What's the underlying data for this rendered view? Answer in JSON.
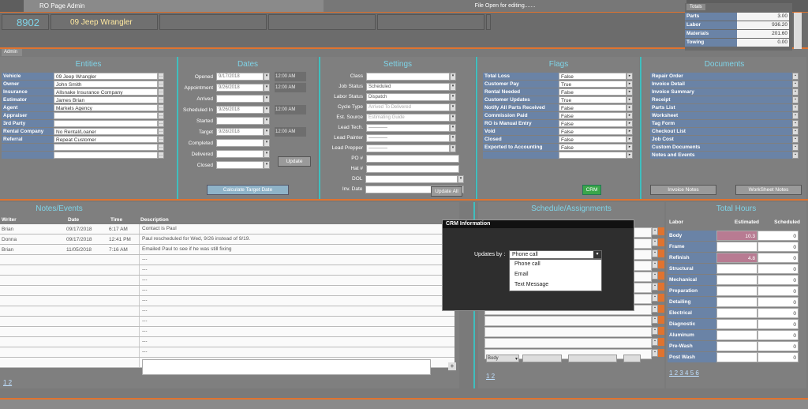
{
  "header": {
    "app_title": "RO Page Admin",
    "status_message": "File Open for editing.......",
    "ro_number": "8902",
    "vehicle_name": "09 Jeep Wrangler",
    "admin_tab": "Admin"
  },
  "totals": {
    "title": "Totals",
    "rows": [
      {
        "label": "Parts",
        "value": "3.00"
      },
      {
        "label": "Labor",
        "value": "936.20"
      },
      {
        "label": "Materials",
        "value": "201.60"
      },
      {
        "label": "Towing",
        "value": "0.00"
      }
    ]
  },
  "entities": {
    "title": "Entities",
    "rows": [
      {
        "label": "Vehicle",
        "value": "09 Jeep Wrangler"
      },
      {
        "label": "Owner",
        "value": "John Smith"
      },
      {
        "label": "Insurance",
        "value": "Allsnake Insurance Company"
      },
      {
        "label": "Estimator",
        "value": "James Brian"
      },
      {
        "label": "Agent",
        "value": "Markels Agency"
      },
      {
        "label": "Appraiser",
        "value": ""
      },
      {
        "label": "3rd Party",
        "value": ""
      },
      {
        "label": "Rental Company",
        "value": "No Rental/Loaner"
      },
      {
        "label": "Referral",
        "value": "Repeat Customer"
      },
      {
        "label": "",
        "value": ""
      },
      {
        "label": "",
        "value": ""
      }
    ]
  },
  "dates": {
    "title": "Dates",
    "rows": [
      {
        "label": "Opened",
        "date": "9/17/2018",
        "time": "12:00 AM"
      },
      {
        "label": "Appointment",
        "date": "9/26/2018",
        "time": "12:00 AM"
      },
      {
        "label": "Arrived",
        "date": "",
        "time": ""
      },
      {
        "label": "Scheduled In",
        "date": "9/26/2018",
        "time": "12:00 AM"
      },
      {
        "label": "Started",
        "date": "",
        "time": ""
      },
      {
        "label": "Target",
        "date": "9/28/2018",
        "time": "12:00 AM"
      },
      {
        "label": "Completed",
        "date": "",
        "time": ""
      },
      {
        "label": "Delivered",
        "date": "",
        "time": ""
      },
      {
        "label": "Closed",
        "date": "",
        "time": ""
      }
    ],
    "update_label": "Update",
    "calc_label": "Calculate Target Date"
  },
  "settings": {
    "title": "Settings",
    "rows": [
      {
        "label": "Class",
        "value": ""
      },
      {
        "label": "Job Status",
        "value": "Scheduled"
      },
      {
        "label": "Labor Status",
        "value": "Dispatch"
      },
      {
        "label": "Cycle Type",
        "value": "Arrived To Delivered"
      },
      {
        "label": "Est. Source",
        "value": "Estimating Guide"
      },
      {
        "label": "Lead Tech.",
        "value": "------------"
      },
      {
        "label": "Lead Painter",
        "value": "------------"
      },
      {
        "label": "Lead Prepper",
        "value": "------------"
      },
      {
        "label": "PO #",
        "value": ""
      },
      {
        "label": "Hat #",
        "value": ""
      },
      {
        "label": "DOL",
        "value": ""
      },
      {
        "label": "Inv. Date",
        "value": ""
      }
    ],
    "update_all_label": "Update All"
  },
  "flags": {
    "title": "Flags",
    "rows": [
      {
        "label": "Total Loss",
        "value": "False"
      },
      {
        "label": "Customer Pay",
        "value": "True"
      },
      {
        "label": "Rental Needed",
        "value": "False"
      },
      {
        "label": "Customer Updates",
        "value": "True"
      },
      {
        "label": "Notify All Parts Received",
        "value": "False"
      },
      {
        "label": "Commission Paid",
        "value": "False"
      },
      {
        "label": "RO is Manual Entry",
        "value": "False"
      },
      {
        "label": "Void",
        "value": "False"
      },
      {
        "label": "Closed",
        "value": "False"
      },
      {
        "label": "Exported to Accounting",
        "value": "False"
      },
      {
        "label": "",
        "value": ""
      }
    ],
    "crm_label": "CRM"
  },
  "documents": {
    "title": "Documents",
    "rows": [
      "Repair Order",
      "Invoice Detail",
      "Invoice Summary",
      "Receipt",
      "Parts List",
      "Worksheet",
      "Tag Form",
      "Checkout List",
      "Job Cost",
      "Custom Documents",
      "Notes and Events"
    ],
    "invoice_notes": "Invoice Notes",
    "worksheet_notes": "WorkSheet Notes"
  },
  "notes": {
    "title": "Notes/Events",
    "cols": [
      "Writer",
      "Date",
      "Time",
      "Description"
    ],
    "rows": [
      {
        "writer": "Brian",
        "date": "09/17/2018",
        "time": "6:17 AM",
        "desc": "Contact is Paul"
      },
      {
        "writer": "Donna",
        "date": "09/17/2018",
        "time": "12:41 PM",
        "desc": "Paul rescheduled for Wed, 9/26 instead of 9/19."
      },
      {
        "writer": "Brian",
        "date": "11/05/2018",
        "time": "7:16 AM",
        "desc": "Emailed Paul to see if he was still fixing"
      }
    ],
    "empty": "---",
    "pager": "1 2"
  },
  "schedule": {
    "title": "Schedule/Assignments",
    "body_select": "Body",
    "pager": "1 2"
  },
  "crm": {
    "title": "CRM Information",
    "updates_label": "Updates by :",
    "selected": "Phone call",
    "options": [
      "Phone call",
      "Email",
      "Text Message"
    ]
  },
  "hours": {
    "title": "Total Hours",
    "cols": [
      "Labor",
      "Estimated",
      "Scheduled"
    ],
    "rows": [
      {
        "label": "Body",
        "est": "10.3",
        "sch": "0"
      },
      {
        "label": "Frame",
        "est": "",
        "sch": "0"
      },
      {
        "label": "Refinish",
        "est": "4.8",
        "sch": "0"
      },
      {
        "label": "Structural",
        "est": "",
        "sch": "0"
      },
      {
        "label": "Mechanical",
        "est": "",
        "sch": "0"
      },
      {
        "label": "Preparation",
        "est": "",
        "sch": "0"
      },
      {
        "label": "Detailing",
        "est": "",
        "sch": "0"
      },
      {
        "label": "Electrical",
        "est": "",
        "sch": "0"
      },
      {
        "label": "Diagnostic",
        "est": "",
        "sch": "0"
      },
      {
        "label": "Aluminum",
        "est": "",
        "sch": "0"
      },
      {
        "label": "Pre-Wash",
        "est": "",
        "sch": "0"
      },
      {
        "label": "Post Wash",
        "est": "",
        "sch": "0"
      }
    ],
    "pager": "1 2 3 4 5 6"
  }
}
